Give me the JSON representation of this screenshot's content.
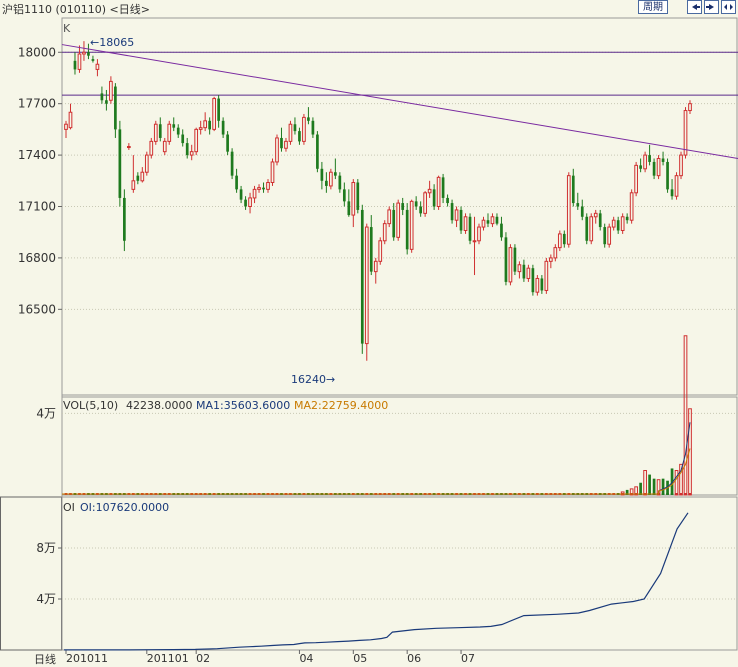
{
  "header": {
    "title": "沪铝1110 (010110) <日线>",
    "period_button": "周期",
    "nav_left_icon": "arrow-left-icon",
    "nav_right_icon": "arrow-right-icon",
    "nav_expand_icon": "arrow-expand-icon"
  },
  "price_panel": {
    "marker": "K",
    "high_label": "←18065",
    "low_label": "16240→"
  },
  "volume_panel": {
    "name": "VOL(5,10)",
    "value": "42238.0000",
    "ma1": "MA1:35603.6000",
    "ma2": "MA2:22759.4000"
  },
  "oi_panel": {
    "name": "OI",
    "value": "OI:107620.0000"
  },
  "x_axis": {
    "period_label": "日线"
  },
  "colors": {
    "up": "#d03030",
    "down": "#1e7a1e",
    "trendline": "#7a2aa0",
    "hline": "#5a2a8a",
    "oi_line": "#1a3a7a",
    "ma1": "#1a3a7a",
    "ma2": "#c87a00",
    "grid": "#c8c8b4",
    "background": "#f6f6e8"
  },
  "chart_data": [
    {
      "type": "candlestick",
      "panel": "price",
      "ylim": [
        16000,
        18200
      ],
      "yticks": [
        16500,
        16800,
        17100,
        17400,
        17700,
        18000
      ],
      "grid": true,
      "xticks": [
        "201011",
        "201101",
        "02",
        "04",
        "05",
        "06",
        "07"
      ],
      "annotations": [
        {
          "text": "←18065",
          "value": 18065
        },
        {
          "text": "16240→",
          "value": 16240
        }
      ],
      "horizontal_lines": [
        18000,
        17750
      ],
      "trendline": {
        "start": 18045,
        "end": 17380
      },
      "candles": [
        [
          17550,
          17600,
          17500,
          17580
        ],
        [
          17560,
          17700,
          17550,
          17650
        ],
        [
          17950,
          18000,
          17870,
          17900
        ],
        [
          17900,
          18040,
          17880,
          17990
        ],
        [
          17990,
          18065,
          17950,
          18000
        ],
        [
          18000,
          18050,
          17960,
          17980
        ],
        [
          17960,
          17980,
          17940,
          17950
        ],
        [
          17900,
          17960,
          17860,
          17930
        ],
        [
          17760,
          17800,
          17700,
          17720
        ],
        [
          17720,
          17780,
          17660,
          17700
        ],
        [
          17720,
          17860,
          17700,
          17830
        ],
        [
          17800,
          17820,
          17500,
          17550
        ],
        [
          17550,
          17600,
          17100,
          17150
        ],
        [
          17150,
          17200,
          16840,
          16900
        ],
        [
          17450,
          17470,
          17430,
          17450
        ],
        [
          17200,
          17400,
          17180,
          17250
        ],
        [
          17280,
          17300,
          17230,
          17250
        ],
        [
          17250,
          17330,
          17240,
          17300
        ],
        [
          17300,
          17420,
          17280,
          17400
        ],
        [
          17400,
          17500,
          17380,
          17480
        ],
        [
          17480,
          17600,
          17460,
          17580
        ],
        [
          17580,
          17620,
          17480,
          17500
        ],
        [
          17420,
          17500,
          17400,
          17480
        ],
        [
          17480,
          17600,
          17460,
          17580
        ],
        [
          17580,
          17620,
          17540,
          17560
        ],
        [
          17560,
          17580,
          17500,
          17520
        ],
        [
          17520,
          17550,
          17450,
          17470
        ],
        [
          17470,
          17500,
          17380,
          17400
        ],
        [
          17400,
          17460,
          17370,
          17420
        ],
        [
          17420,
          17560,
          17400,
          17550
        ],
        [
          17550,
          17600,
          17520,
          17560
        ],
        [
          17560,
          17650,
          17540,
          17600
        ],
        [
          17600,
          17620,
          17520,
          17550
        ],
        [
          17550,
          17740,
          17540,
          17730
        ],
        [
          17730,
          17750,
          17560,
          17600
        ],
        [
          17600,
          17620,
          17500,
          17520
        ],
        [
          17520,
          17540,
          17400,
          17420
        ],
        [
          17420,
          17440,
          17260,
          17280
        ],
        [
          17280,
          17320,
          17180,
          17200
        ],
        [
          17200,
          17220,
          17120,
          17140
        ],
        [
          17140,
          17160,
          17080,
          17100
        ],
        [
          17100,
          17180,
          17060,
          17150
        ],
        [
          17150,
          17220,
          17120,
          17200
        ],
        [
          17200,
          17230,
          17180,
          17210
        ],
        [
          17210,
          17240,
          17180,
          17200
        ],
        [
          17200,
          17260,
          17180,
          17240
        ],
        [
          17240,
          17380,
          17220,
          17360
        ],
        [
          17360,
          17520,
          17340,
          17500
        ],
        [
          17500,
          17560,
          17420,
          17440
        ],
        [
          17440,
          17500,
          17420,
          17480
        ],
        [
          17480,
          17600,
          17460,
          17580
        ],
        [
          17580,
          17620,
          17520,
          17540
        ],
        [
          17540,
          17560,
          17460,
          17480
        ],
        [
          17480,
          17640,
          17460,
          17620
        ],
        [
          17620,
          17680,
          17580,
          17600
        ],
        [
          17600,
          17620,
          17500,
          17520
        ],
        [
          17520,
          17540,
          17300,
          17320
        ],
        [
          17320,
          17360,
          17200,
          17250
        ],
        [
          17250,
          17300,
          17180,
          17220
        ],
        [
          17220,
          17320,
          17200,
          17300
        ],
        [
          17300,
          17380,
          17260,
          17280
        ],
        [
          17280,
          17300,
          17180,
          17200
        ],
        [
          17200,
          17240,
          17100,
          17130
        ],
        [
          17130,
          17200,
          17040,
          17050
        ],
        [
          17050,
          17260,
          16980,
          17240
        ],
        [
          17240,
          17260,
          17060,
          17080
        ],
        [
          17080,
          17110,
          16240,
          16300
        ],
        [
          16300,
          17000,
          16200,
          16980
        ],
        [
          16980,
          17050,
          16700,
          16720
        ],
        [
          16720,
          16800,
          16650,
          16780
        ],
        [
          16780,
          16920,
          16760,
          16900
        ],
        [
          16900,
          17020,
          16880,
          17000
        ],
        [
          17000,
          17100,
          16980,
          17080
        ],
        [
          17080,
          17120,
          16900,
          16920
        ],
        [
          16920,
          17140,
          16900,
          17120
        ],
        [
          17120,
          17150,
          17050,
          17080
        ],
        [
          17080,
          17120,
          16820,
          16850
        ],
        [
          16850,
          17140,
          16830,
          17130
        ],
        [
          17130,
          17160,
          17080,
          17100
        ],
        [
          17100,
          17130,
          17040,
          17060
        ],
        [
          17060,
          17190,
          17040,
          17180
        ],
        [
          17180,
          17250,
          17150,
          17200
        ],
        [
          17200,
          17230,
          17080,
          17100
        ],
        [
          17100,
          17280,
          17080,
          17270
        ],
        [
          17270,
          17290,
          17120,
          17150
        ],
        [
          17150,
          17170,
          17100,
          17120
        ],
        [
          17120,
          17140,
          17000,
          17020
        ],
        [
          17020,
          17100,
          16980,
          17080
        ],
        [
          17080,
          17100,
          16940,
          16960
        ],
        [
          16960,
          17060,
          16940,
          17040
        ],
        [
          17040,
          17060,
          16880,
          16900
        ],
        [
          16900,
          17040,
          16700,
          16900
        ],
        [
          16900,
          17000,
          16880,
          16980
        ],
        [
          16980,
          17040,
          16960,
          17020
        ],
        [
          17020,
          17060,
          16980,
          17000
        ],
        [
          17000,
          17060,
          16980,
          17040
        ],
        [
          17040,
          17060,
          16990,
          17000
        ],
        [
          17000,
          17040,
          16900,
          16920
        ],
        [
          16920,
          16950,
          16640,
          16660
        ],
        [
          16660,
          16880,
          16640,
          16860
        ],
        [
          16860,
          16880,
          16700,
          16720
        ],
        [
          16720,
          16780,
          16680,
          16760
        ],
        [
          16760,
          16790,
          16660,
          16680
        ],
        [
          16680,
          16760,
          16660,
          16740
        ],
        [
          16740,
          16760,
          16580,
          16600
        ],
        [
          16600,
          16700,
          16580,
          16680
        ],
        [
          16680,
          16700,
          16590,
          16610
        ],
        [
          16610,
          16800,
          16590,
          16780
        ],
        [
          16780,
          16820,
          16740,
          16800
        ],
        [
          16800,
          16880,
          16780,
          16860
        ],
        [
          16860,
          16960,
          16840,
          16940
        ],
        [
          16940,
          16960,
          16860,
          16880
        ],
        [
          16880,
          17300,
          16860,
          17280
        ],
        [
          17280,
          17320,
          17100,
          17120
        ],
        [
          17120,
          17180,
          17080,
          17100
        ],
        [
          17100,
          17140,
          17020,
          17040
        ],
        [
          17040,
          17060,
          16880,
          16900
        ],
        [
          16900,
          17060,
          16880,
          17040
        ],
        [
          17040,
          17080,
          17000,
          17060
        ],
        [
          17060,
          17080,
          16960,
          16980
        ],
        [
          16980,
          17000,
          16860,
          16880
        ],
        [
          16880,
          17000,
          16860,
          16980
        ],
        [
          16980,
          17040,
          16960,
          17020
        ],
        [
          17020,
          17040,
          16940,
          16960
        ],
        [
          16960,
          17060,
          16940,
          17040
        ],
        [
          17040,
          17060,
          17000,
          17020
        ],
        [
          17020,
          17200,
          17000,
          17180
        ],
        [
          17180,
          17360,
          17160,
          17340
        ],
        [
          17340,
          17380,
          17300,
          17320
        ],
        [
          17320,
          17420,
          17300,
          17400
        ],
        [
          17400,
          17460,
          17340,
          17360
        ],
        [
          17360,
          17380,
          17260,
          17280
        ],
        [
          17280,
          17400,
          17260,
          17380
        ],
        [
          17380,
          17420,
          17340,
          17360
        ],
        [
          17360,
          17380,
          17180,
          17200
        ],
        [
          17200,
          17260,
          17140,
          17160
        ],
        [
          17160,
          17300,
          17140,
          17280
        ],
        [
          17280,
          17420,
          17260,
          17400
        ],
        [
          17400,
          17680,
          17380,
          17660
        ],
        [
          17660,
          17720,
          17640,
          17700
        ]
      ]
    },
    {
      "type": "bar",
      "panel": "volume",
      "ylim": [
        0,
        48000
      ],
      "yticks": [
        40000
      ],
      "ytick_labels": [
        "4万"
      ],
      "last_value": 42238,
      "recent_values": [
        1500,
        2500,
        3000,
        4000,
        6000,
        12000,
        10000,
        8000,
        7500,
        8000,
        7000,
        13000,
        12000,
        15000,
        78000,
        42238
      ],
      "ma1_last": 35603.6,
      "ma2_last": 22759.4
    },
    {
      "type": "line",
      "panel": "oi",
      "ylim": [
        0,
        120000
      ],
      "yticks": [
        40000,
        80000
      ],
      "ytick_labels": [
        "4万",
        "8万"
      ],
      "last_value": 107620,
      "values": [
        100,
        100,
        100,
        100,
        200,
        300,
        500,
        1000,
        2200,
        2600,
        3000,
        3500,
        4000,
        4300,
        5000,
        5600,
        5700,
        6100,
        6600,
        7000,
        7500,
        8000,
        9000,
        10000,
        14000,
        16000,
        17000,
        17500,
        18000,
        18500,
        20000,
        27000,
        28000,
        29000,
        31000,
        36000,
        37000,
        38000,
        40000,
        60000,
        95000,
        107620
      ],
      "index_positions": [
        0,
        20,
        40,
        60,
        80,
        100,
        120,
        140,
        160,
        170,
        180,
        190,
        200,
        210,
        215,
        220,
        230,
        240,
        250,
        260,
        270,
        280,
        290,
        295,
        300,
        320,
        340,
        360,
        380,
        390,
        400,
        420,
        450,
        470,
        480,
        500,
        510,
        520,
        530,
        545,
        560,
        570
      ]
    }
  ]
}
